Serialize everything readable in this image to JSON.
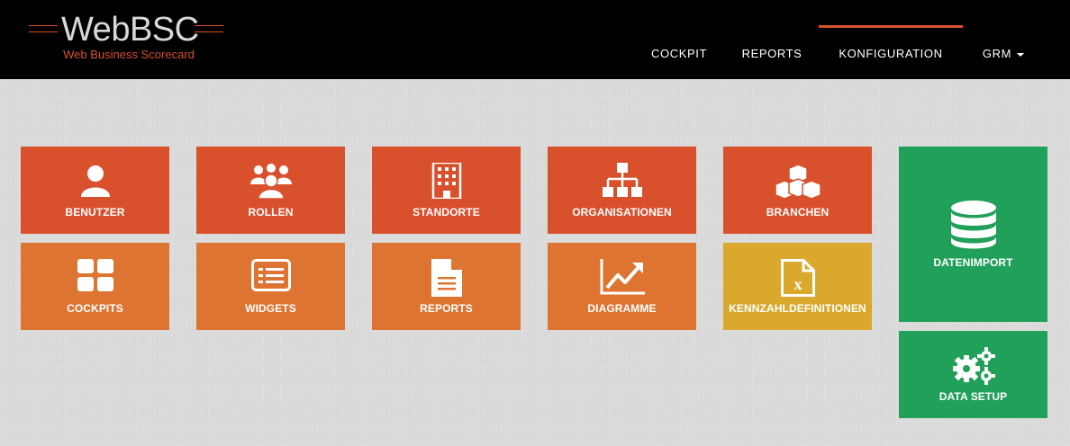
{
  "header": {
    "logo_title": "WebBSC",
    "logo_subtitle": "Web Business Scorecard",
    "nav": [
      {
        "label": "COCKPIT"
      },
      {
        "label": "REPORTS"
      },
      {
        "label": "KONFIGURATION",
        "active": true
      },
      {
        "label": "GRM",
        "dropdown": true
      }
    ]
  },
  "tiles": [
    {
      "label": "BENUTZER",
      "icon": "user-icon",
      "color": "#d9502c"
    },
    {
      "label": "ROLLEN",
      "icon": "users-icon",
      "color": "#d9502c"
    },
    {
      "label": "STANDORTE",
      "icon": "building-icon",
      "color": "#d9502c"
    },
    {
      "label": "ORGANISATIONEN",
      "icon": "sitemap-icon",
      "color": "#d9502c"
    },
    {
      "label": "BRANCHEN",
      "icon": "cubes-icon",
      "color": "#d9502c"
    },
    {
      "label": "COCKPITS",
      "icon": "grid-icon",
      "color": "#de7431"
    },
    {
      "label": "WIDGETS",
      "icon": "list-alt-icon",
      "color": "#de7431"
    },
    {
      "label": "REPORTS",
      "icon": "file-text-icon",
      "color": "#de7431"
    },
    {
      "label": "DIAGRAMME",
      "icon": "line-chart-icon",
      "color": "#de7431"
    },
    {
      "label": "KENNZAHLDEFINITIONEN",
      "icon": "excel-file-icon",
      "color": "#d9a82c"
    },
    {
      "label": "DATENIMPORT",
      "icon": "database-icon",
      "color": "#21a05a"
    },
    {
      "label": "DATA SETUP",
      "icon": "gears-icon",
      "color": "#21a05a"
    }
  ],
  "colors": {
    "header_bg": "#000000",
    "accent": "#d9502c",
    "tile_red": "#d9502c",
    "tile_orange": "#de7431",
    "tile_yellow": "#d9a82c",
    "tile_green": "#21a05a"
  }
}
